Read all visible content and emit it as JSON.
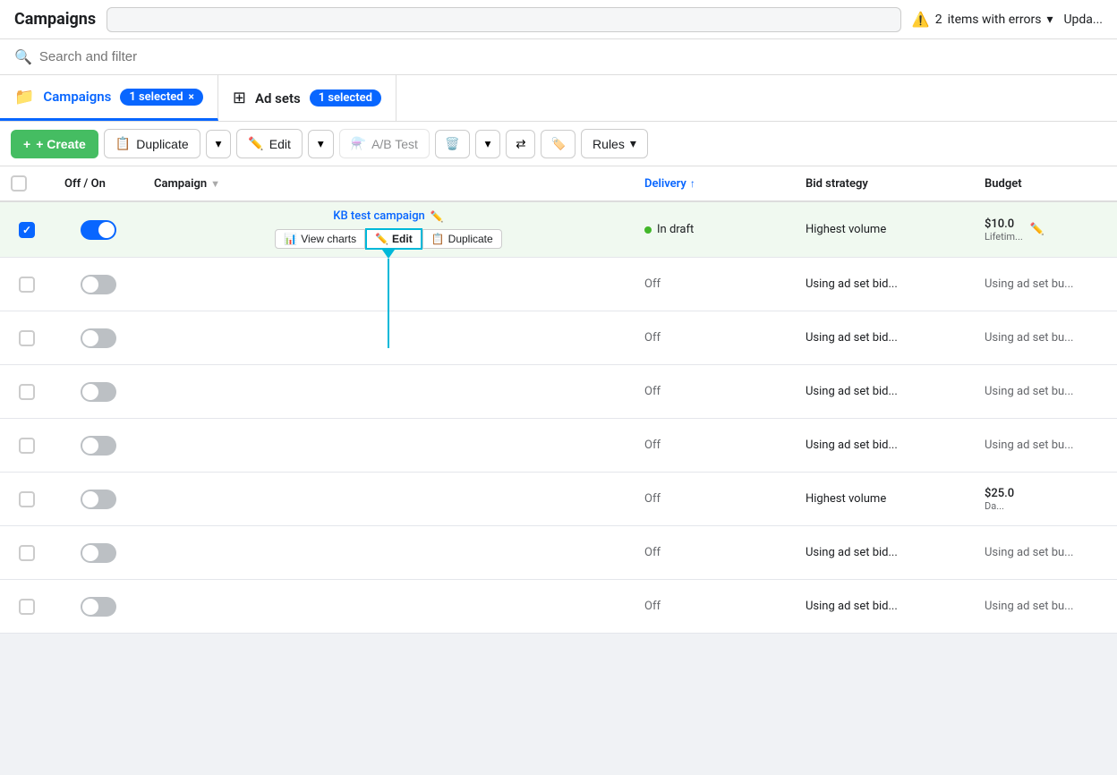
{
  "topbar": {
    "title": "Campaigns",
    "error_count": "2",
    "error_label": "items with errors",
    "update_label": "Upda..."
  },
  "search": {
    "placeholder": "Search and filter"
  },
  "tabs": {
    "campaigns": {
      "label": "Campaigns",
      "selected_label": "1 selected",
      "selected_close": "×"
    },
    "adsets": {
      "label": "Ad sets",
      "selected_label": "1 selected"
    }
  },
  "toolbar": {
    "create_label": "+ Create",
    "duplicate_label": "Duplicate",
    "edit_label": "Edit",
    "ab_test_label": "A/B Test",
    "rules_label": "Rules"
  },
  "table": {
    "headers": {
      "off_on": "Off / On",
      "campaign": "Campaign",
      "delivery": "Delivery",
      "bid_strategy": "Bid strategy",
      "budget": "Budget"
    },
    "rows": [
      {
        "id": 1,
        "checked": true,
        "toggle": "on",
        "campaign_name": "KB test campaign",
        "delivery": "In draft",
        "delivery_status": "green",
        "bid_strategy": "Highest volume",
        "budget_amount": "$10.0",
        "budget_period": "Lifetim...",
        "highlighted": true,
        "show_actions": true
      },
      {
        "id": 2,
        "checked": false,
        "toggle": "off",
        "campaign_name": "",
        "delivery": "Off",
        "delivery_status": "off",
        "bid_strategy": "Using ad set bid...",
        "budget_amount": "Using ad set bu...",
        "budget_period": "",
        "highlighted": false
      },
      {
        "id": 3,
        "checked": false,
        "toggle": "off",
        "campaign_name": "",
        "delivery": "Off",
        "delivery_status": "off",
        "bid_strategy": "Using ad set bid...",
        "budget_amount": "Using ad set bu...",
        "budget_period": "",
        "highlighted": false
      },
      {
        "id": 4,
        "checked": false,
        "toggle": "off",
        "campaign_name": "",
        "delivery": "Off",
        "delivery_status": "off",
        "bid_strategy": "Using ad set bid...",
        "budget_amount": "Using ad set bu...",
        "budget_period": "",
        "highlighted": false
      },
      {
        "id": 5,
        "checked": false,
        "toggle": "off",
        "campaign_name": "",
        "delivery": "Off",
        "delivery_status": "off",
        "bid_strategy": "Using ad set bid...",
        "budget_amount": "Using ad set bu...",
        "budget_period": "",
        "highlighted": false
      },
      {
        "id": 6,
        "checked": false,
        "toggle": "off",
        "campaign_name": "",
        "delivery": "Off",
        "delivery_status": "off",
        "bid_strategy": "Highest volume",
        "budget_amount": "$25.0",
        "budget_period": "Da...",
        "highlighted": false
      },
      {
        "id": 7,
        "checked": false,
        "toggle": "off",
        "campaign_name": "",
        "delivery": "Off",
        "delivery_status": "off",
        "bid_strategy": "Using ad set bid...",
        "budget_amount": "Using ad set bu...",
        "budget_period": "",
        "highlighted": false
      },
      {
        "id": 8,
        "checked": false,
        "toggle": "off",
        "campaign_name": "",
        "delivery": "Off",
        "delivery_status": "off",
        "bid_strategy": "Using ad set bid...",
        "budget_amount": "Using ad set bu...",
        "budget_period": "",
        "highlighted": false
      }
    ],
    "inline_actions": {
      "view_charts": "View charts",
      "edit": "Edit",
      "duplicate": "Duplicate"
    }
  }
}
